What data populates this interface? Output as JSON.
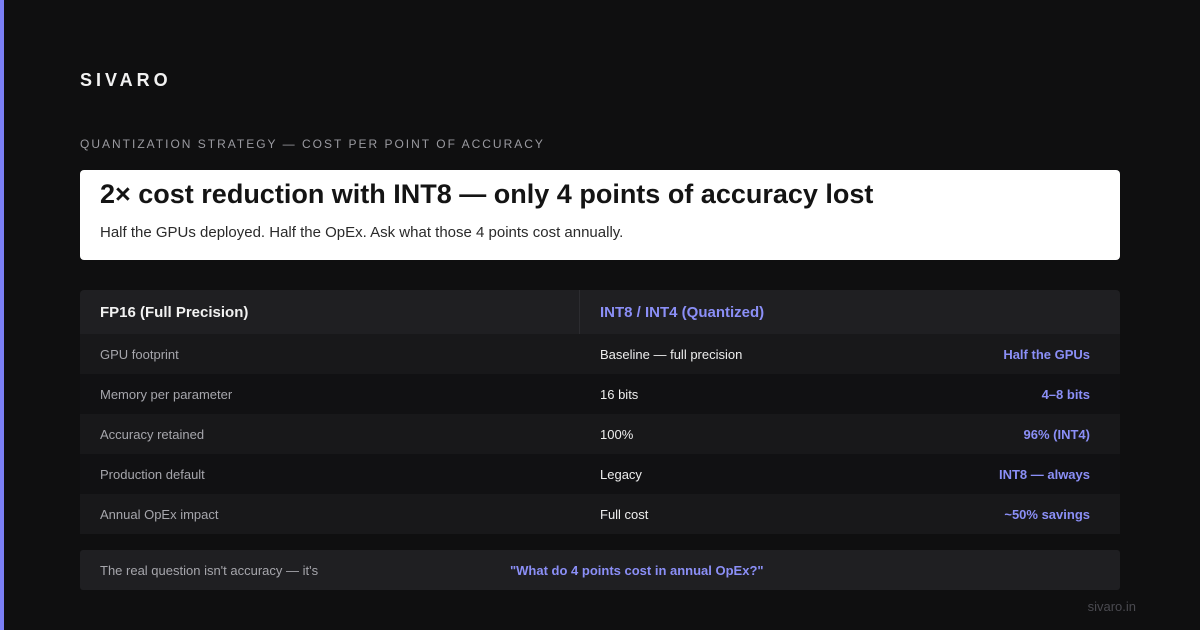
{
  "brand": "SIVARO",
  "eyebrow": "QUANTIZATION STRATEGY — COST PER POINT OF ACCURACY",
  "headline": {
    "title": "2× cost reduction with INT8 — only 4 points of accuracy lost",
    "subtitle": "Half the GPUs deployed. Half the OpEx. Ask what those 4 points cost annually."
  },
  "table": {
    "header_left": "FP16 (Full Precision)",
    "header_right": "INT8 / INT4 (Quantized)",
    "rows": [
      {
        "label": "GPU footprint",
        "baseline": "Baseline — full precision",
        "quantized": "Half the GPUs"
      },
      {
        "label": "Memory per parameter",
        "baseline": "16 bits",
        "quantized": "4–8 bits"
      },
      {
        "label": "Accuracy retained",
        "baseline": "100%",
        "quantized": "96% (INT4)"
      },
      {
        "label": "Production default",
        "baseline": "Legacy",
        "quantized": "INT8 — always"
      },
      {
        "label": "Annual OpEx impact",
        "baseline": "Full cost",
        "quantized": "~50% savings"
      }
    ]
  },
  "footer": {
    "lead": "The real question isn't accuracy — it's",
    "quote": "\"What do 4 points cost in annual OpEx?\""
  },
  "site": "sivaro.in",
  "colors": {
    "accent": "#7b7ff5",
    "highlight_text": "#8b8ff7",
    "background": "#0f0f10"
  }
}
